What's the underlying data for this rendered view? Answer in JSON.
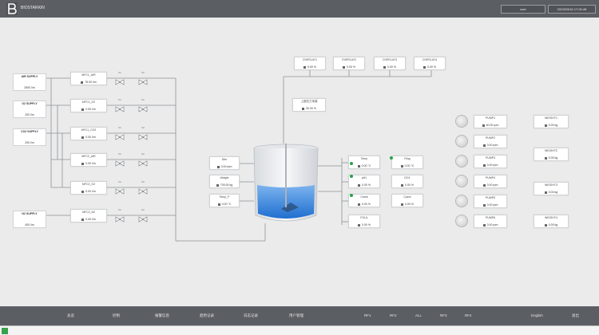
{
  "header": {
    "logo_text": "BIOSTARKIN",
    "user": "user",
    "datetime": "2023/03/16 17:00:48"
  },
  "supplies": [
    {
      "name": "AIR SUPPLY",
      "value": "2500",
      "unit": "l/m"
    },
    {
      "name": "O2 SUPPLY",
      "value": "200",
      "unit": "l/m"
    },
    {
      "name": "CO2 SUPPLY",
      "value": "200",
      "unit": "l/m"
    },
    {
      "name": "N2 SUPPLY",
      "value": "400",
      "unit": "l/m"
    }
  ],
  "mfcs": [
    {
      "label": "MFC1_AIR",
      "value": "78.00",
      "unit": "l/m"
    },
    {
      "label": "MFC1_O2",
      "value": "0.00",
      "unit": "l/m"
    },
    {
      "label": "MFC1_CO2",
      "value": "0.00",
      "unit": "l/m"
    },
    {
      "label": "MFC2_AIR",
      "value": "0.00",
      "unit": "l/m"
    },
    {
      "label": "MFC2_O2",
      "value": "0.00",
      "unit": "l/m"
    },
    {
      "label": "MFC2_N2",
      "value": "0.00",
      "unit": "l/m"
    }
  ],
  "valve_labels": [
    "V1",
    "V2"
  ],
  "overlay": [
    {
      "label": "OVERLAY1",
      "value": "0.00",
      "unit": "%"
    },
    {
      "label": "OVERLAY2",
      "value": "0.00",
      "unit": "%"
    },
    {
      "label": "OVERLAY3",
      "value": "0.00",
      "unit": "%"
    },
    {
      "label": "OVERLAY4",
      "value": "0.00",
      "unit": "%"
    }
  ],
  "pressure": {
    "label": "上部压力传感",
    "value": "30.00",
    "unit": "%"
  },
  "tank_inputs": [
    {
      "label": "Stirr",
      "value": "0.00",
      "unit": "rpm"
    },
    {
      "label": "Weight",
      "value": "700.00",
      "unit": "kg"
    },
    {
      "label": "Temp_P",
      "value": "0.00",
      "unit": "°C"
    }
  ],
  "sensors": [
    {
      "label": "Temp",
      "value": "0.00",
      "unit": "°C"
    },
    {
      "label": "Ring",
      "value": "0.00",
      "unit": "°C"
    },
    {
      "label": "pH1",
      "value": "0.00",
      "unit": "%"
    },
    {
      "label": "DO1",
      "value": "0.00",
      "unit": "%"
    },
    {
      "label": "Camb",
      "value": "0.00",
      "unit": "%"
    },
    {
      "label": "Cpenr",
      "value": "0.00",
      "unit": "%"
    },
    {
      "label": "FOUL",
      "value": "0.00",
      "unit": "%"
    }
  ],
  "pumps": [
    {
      "label": "PUMP1",
      "value": "40.00",
      "unit": "rpm"
    },
    {
      "label": "PUMP2",
      "value": "0.00",
      "unit": "rpm"
    },
    {
      "label": "PUMP3",
      "value": "0.00",
      "unit": "rpm"
    },
    {
      "label": "PUMP4",
      "value": "0.00",
      "unit": "rpm"
    },
    {
      "label": "PUMP5",
      "value": "0.00",
      "unit": "rpm"
    },
    {
      "label": "PUMP6",
      "value": "0.00",
      "unit": "rpm"
    }
  ],
  "weights": [
    {
      "label": "WEIGHT1",
      "value": "0.00",
      "unit": "kg"
    },
    {
      "label": "WEIGHT2",
      "value": "0.00",
      "unit": "kg"
    },
    {
      "label": "WEIGHT3",
      "value": "0.00",
      "unit": "kg"
    },
    {
      "label": "WEIGHT4",
      "value": "0.00",
      "unit": "kg"
    }
  ],
  "nav": {
    "items": [
      "总览",
      "控制",
      "报警信息",
      "趋势记录",
      "日志记录",
      "用户管理"
    ],
    "tabs": [
      "RF1",
      "RF2",
      "ALL",
      "RF3",
      "RF4"
    ],
    "lang": "English",
    "exit": "退出"
  },
  "colors": {
    "bar": "#5b5e63",
    "bg": "#ebebeb",
    "liquid": "#3a86d8",
    "ok": "#2aa04a"
  }
}
